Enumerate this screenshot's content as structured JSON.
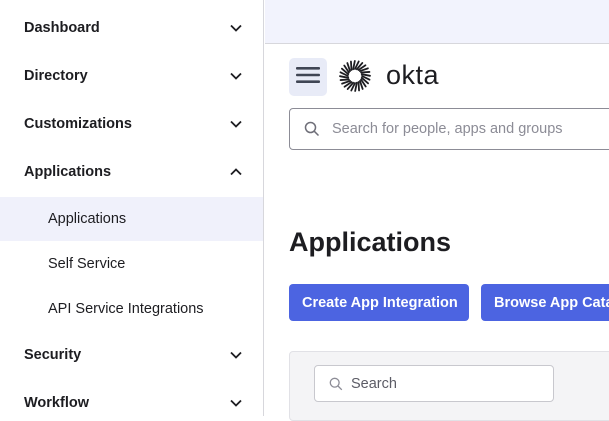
{
  "sidebar": {
    "sections": [
      {
        "label": "Dashboard",
        "expanded": false
      },
      {
        "label": "Directory",
        "expanded": false
      },
      {
        "label": "Customizations",
        "expanded": false
      },
      {
        "label": "Applications",
        "expanded": true
      },
      {
        "label": "Security",
        "expanded": false
      },
      {
        "label": "Workflow",
        "expanded": false
      }
    ],
    "applications_items": [
      {
        "label": "Applications",
        "active": true
      },
      {
        "label": "Self Service",
        "active": false
      },
      {
        "label": "API Service Integrations",
        "active": false
      }
    ]
  },
  "header": {
    "menu_icon": "hamburger-menu-icon",
    "logo_icon": "okta-sunburst-icon",
    "logo_text": "okta",
    "search": {
      "placeholder": "Search for people, apps and groups"
    }
  },
  "main": {
    "title": "Applications",
    "buttons": {
      "create": "Create App Integration",
      "browse": "Browse App Catalog"
    },
    "filter_search": {
      "placeholder": "Search"
    }
  },
  "colors": {
    "accent": "#4c64e1",
    "active_nav_bg": "#f0f1fb",
    "topbar_bg": "#f2f3fd"
  }
}
